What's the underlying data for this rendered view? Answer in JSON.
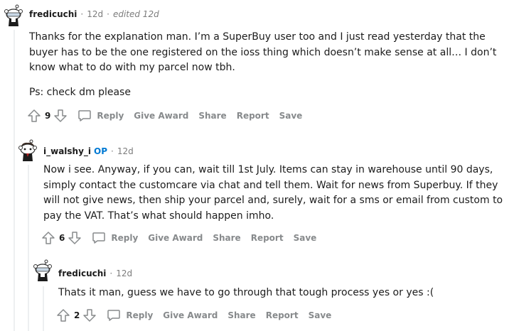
{
  "comments": [
    {
      "author": "fredicuchi",
      "time": "12d",
      "edited": "edited 12d",
      "paragraphs": [
        "Thanks for the explanation man. I’m a SuperBuy user too and I just read yesterday that the buyer has to be the one registered on the ioss thing which doesn’t make sense at all… I don’t know what to do with my parcel now tbh.",
        "Ps: check dm please"
      ],
      "score": "9"
    },
    {
      "author": "i_walshy_i",
      "op_badge": "OP",
      "time": "12d",
      "paragraphs": [
        "Now i see. Anyway, if you can, wait till 1st July. Items can stay in warehouse until 90 days, simply contact the customcare via chat and tell them. Wait for news from Superbuy. If they will not give news, then ship your parcel and, surely, wait for a sms or email from custom to pay the VAT. That’s what should happen imho."
      ],
      "score": "6"
    },
    {
      "author": "fredicuchi",
      "time": "12d",
      "paragraphs": [
        "Thats it man, guess we have to go through that tough process yes or yes :("
      ],
      "score": "2"
    }
  ],
  "actions": {
    "reply": "Reply",
    "give_award": "Give Award",
    "share": "Share",
    "report": "Report",
    "save": "Save"
  },
  "separator": "·",
  "icons": {
    "upvote": "upvote-arrow-icon",
    "downvote": "downvote-arrow-icon",
    "reply": "chat-bubble-icon"
  },
  "colors": {
    "op_badge": "#0079d3",
    "meta_text": "#7c7c7c",
    "action_text": "#878a8c",
    "thread_line": "#edeff1"
  }
}
